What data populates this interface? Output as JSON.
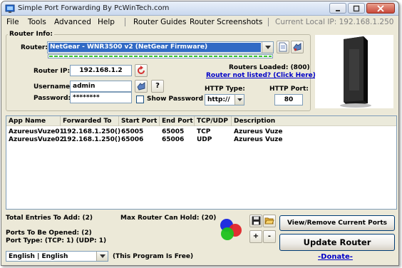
{
  "window": {
    "title": "Simple Port Forwarding By PcWinTech.com"
  },
  "menu": {
    "items": [
      "File",
      "Tools",
      "Advanced",
      "Help",
      "Router Guides",
      "Router Screenshots"
    ],
    "local_ip": "Current Local IP: 192.168.1.250"
  },
  "router_info": {
    "group_label": "Router Info:",
    "router_label": "Router:",
    "router_selected": "NetGear - WNR3500 v2 (NetGear Firmware)",
    "router_ip_label": "Router IP:",
    "router_ip": "192.168.1.2",
    "routers_loaded": "Routers Loaded: (800)",
    "router_not_listed": "Router not listed? (Click Here)",
    "username_label": "Username:",
    "username": "admin",
    "help_button": "?",
    "password_label": "Password:",
    "password": "********",
    "show_password_label": "Show Password",
    "http_type_label": "HTTP Type:",
    "http_type": "http://",
    "http_port_label": "HTTP Port:",
    "http_port": "80"
  },
  "table": {
    "columns": [
      "App Name",
      "Forwarded To",
      "Start Port",
      "End Port",
      "TCP/UDP",
      "Description"
    ],
    "rows": [
      [
        "AzureusVuze01",
        "192.168.1.250()",
        "65005",
        "65005",
        "TCP",
        "Azureus Vuze"
      ],
      [
        "AzureusVuze02",
        "192.168.1.250()",
        "65006",
        "65006",
        "UDP",
        "Azureus Vuze"
      ]
    ]
  },
  "stats": {
    "total_entries": "Total Entries To Add: (2)",
    "max_router": "Max Router Can Hold: (20)",
    "ports_opened": "Ports To Be Opened: (2)",
    "port_type": "Port Type: (TCP: 1) (UDP: 1)"
  },
  "buttons": {
    "add": "+",
    "remove": "-",
    "view_remove": "View/Remove Current Ports",
    "update": "Update Router",
    "donate": "-Donate-"
  },
  "footer": {
    "language": "English | English",
    "free_note": "(This Program Is Free)"
  },
  "colors": {
    "selection": "#316ac5",
    "progress": "#35c22b",
    "link": "#0000c8",
    "window_bg": "#ece9d8"
  },
  "progress": {
    "percent": 100
  }
}
